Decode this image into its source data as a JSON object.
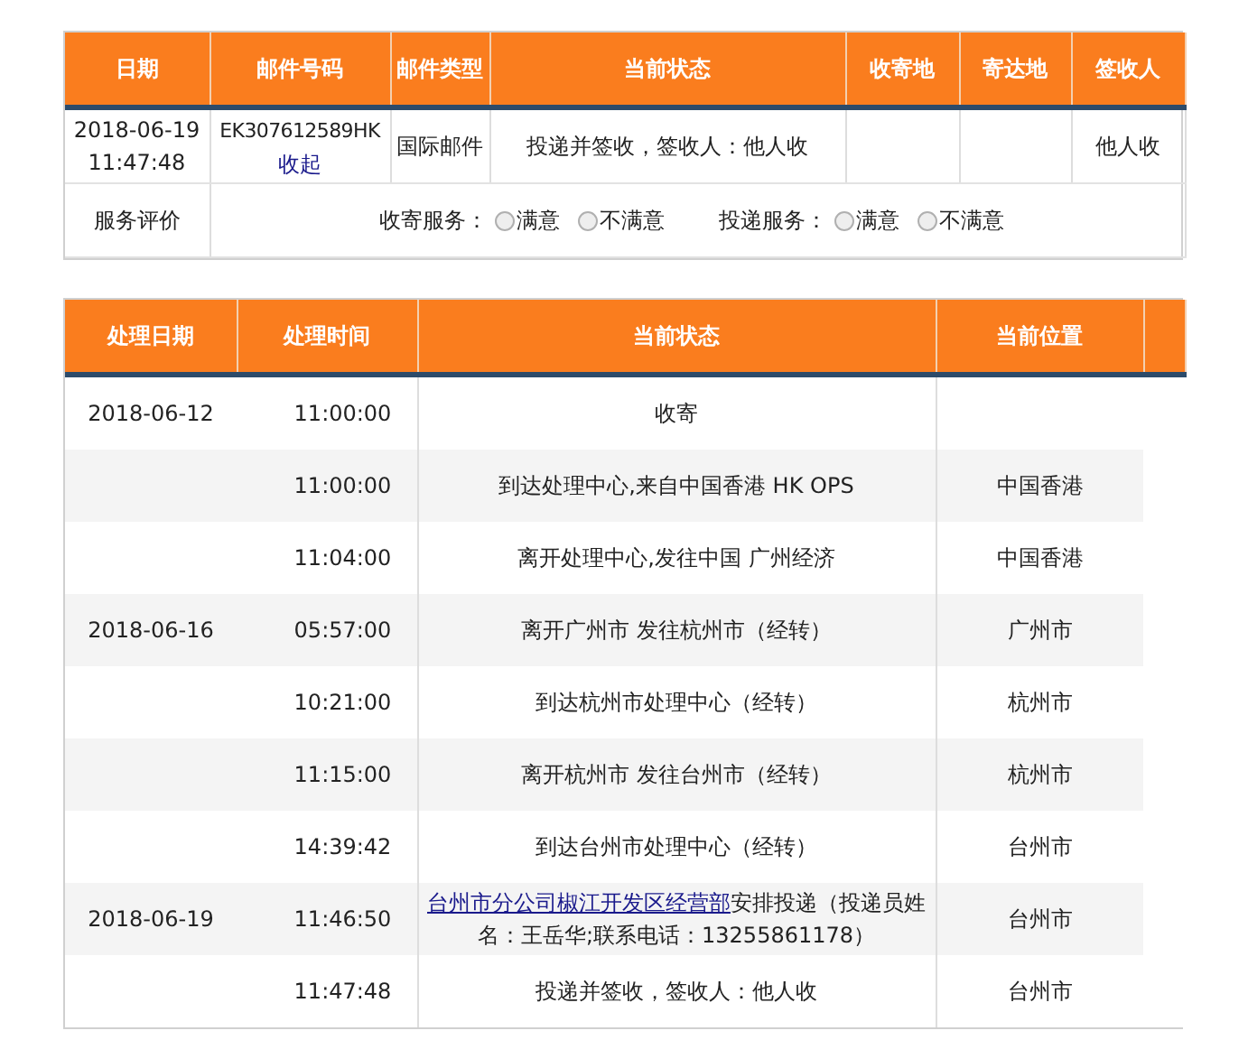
{
  "summary": {
    "columns": [
      "日期",
      "邮件号码",
      "邮件类型",
      "当前状态",
      "收寄地",
      "寄达地",
      "签收人"
    ],
    "row": {
      "date": "2018-06-19 11:47:48",
      "number": "EK307612589HK",
      "collapse_link": "收起",
      "type": "国际邮件",
      "status": "投递并签收，签收人：他人收",
      "signer": "他人收"
    },
    "rating": {
      "label": "服务评价",
      "groups": [
        {
          "label": "收寄服务：",
          "options": [
            {
              "label": "满意",
              "selected": false
            },
            {
              "label": "不满意",
              "selected": false
            }
          ]
        },
        {
          "label": "投递服务：",
          "options": [
            {
              "label": "满意",
              "selected": false
            },
            {
              "label": "不满意",
              "selected": false
            }
          ]
        }
      ]
    }
  },
  "tracking": {
    "columns": [
      "处理日期",
      "处理时间",
      "当前状态",
      "当前位置"
    ],
    "rows": [
      {
        "date": "2018-06-12",
        "time": "11:00:00",
        "status": "收寄"
      },
      {
        "time": "11:00:00",
        "status": "到达处理中心,来自中国香港 HK OPS",
        "location": "中国香港"
      },
      {
        "time": "11:04:00",
        "status": "离开处理中心,发往中国 广州经济",
        "location": "中国香港"
      },
      {
        "date": "2018-06-16",
        "time": "05:57:00",
        "status": "离开广州市 发往杭州市（经转）",
        "location": "广州市"
      },
      {
        "time": "10:21:00",
        "status": "到达杭州市处理中心（经转）",
        "location": "杭州市"
      },
      {
        "time": "11:15:00",
        "status": "离开杭州市 发往台州市（经转）",
        "location": "杭州市"
      },
      {
        "time": "14:39:42",
        "status": "到达台州市处理中心（经转）",
        "location": "台州市"
      },
      {
        "date": "2018-06-19",
        "time": "11:46:50",
        "status_link": "台州市分公司椒江开发区经营部",
        "status": "安排投递（投递员姓名：王岳华;联系电话：13255861178）",
        "location": "台州市"
      },
      {
        "time": "11:47:48",
        "status": "投递并签收，签收人：他人收",
        "location": "台州市"
      }
    ]
  }
}
